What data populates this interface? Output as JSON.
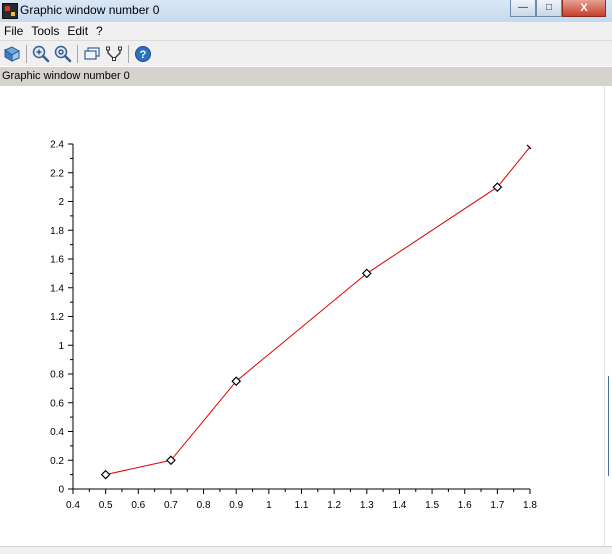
{
  "window": {
    "title": "Graphic window number 0",
    "minimize_glyph": "—",
    "maximize_glyph": "□",
    "close_glyph": "X"
  },
  "menu": {
    "items": [
      "File",
      "Tools",
      "Edit",
      "?"
    ]
  },
  "toolbar": {
    "icons": [
      "rotate-icon",
      "zoom-in-icon",
      "zoom-out-icon",
      "select-figure-icon",
      "datatip-icon",
      "help-icon"
    ]
  },
  "infobar": {
    "text": "Graphic window number 0"
  },
  "chart_data": {
    "type": "line",
    "title": "",
    "xlabel": "",
    "ylabel": "",
    "xlim": [
      0.4,
      1.8
    ],
    "ylim": [
      0,
      2.4
    ],
    "x_ticks": [
      "0.4",
      "0.5",
      "0.6",
      "0.7",
      "0.8",
      "0.9",
      "1",
      "1.1",
      "1.2",
      "1.3",
      "1.4",
      "1.5",
      "1.6",
      "1.7",
      "1.8"
    ],
    "y_ticks": [
      "0",
      "0.2",
      "0.4",
      "0.6",
      "0.8",
      "1",
      "1.2",
      "1.4",
      "1.6",
      "1.8",
      "2",
      "2.2",
      "2.4"
    ],
    "line_color": "#e00000",
    "marker": "diamond",
    "series": [
      {
        "x": [
          0.5,
          0.7,
          0.9,
          1.3,
          1.7,
          1.8
        ],
        "y": [
          0.1,
          0.2,
          0.75,
          1.5,
          2.1,
          2.38
        ]
      }
    ],
    "marker_points": [
      0,
      1,
      2,
      3,
      4
    ],
    "grid": false,
    "legend": "none"
  }
}
